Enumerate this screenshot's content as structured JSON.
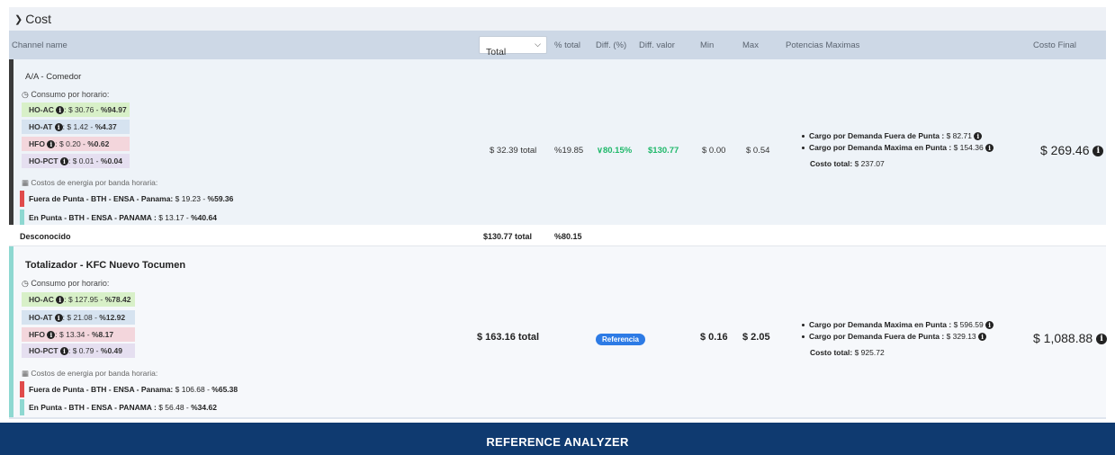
{
  "section": {
    "label": "Cost"
  },
  "header": {
    "channel_name": "Channel name",
    "total_select": "Total",
    "pct_total": "% total",
    "diff_pct": "Diff. (%)",
    "diff_valor": "Diff. valor",
    "min": "Min",
    "max": "Max",
    "potencias": "Potencias Maximas",
    "costo_final": "Costo Final"
  },
  "row1": {
    "name": "A/A - Comedor",
    "consumo_label": "Consumo por horario:",
    "horarios": [
      {
        "code": "HO-AC",
        "value": ": $ 30.76 - ",
        "pct": "%94.97"
      },
      {
        "code": "HO-AT",
        "value": ": $ 1.42 - ",
        "pct": "%4.37"
      },
      {
        "code": "HFO",
        "value": ": $ 0.20 - ",
        "pct": "%0.62"
      },
      {
        "code": "HO-PCT",
        "value": ": $ 0.01 - ",
        "pct": "%0.04"
      }
    ],
    "energia_label": "Costos de energia por banda horaria:",
    "bandas": [
      {
        "name": "Fuera de Punta - BTH - ENSA - Panama:",
        "value": " $ 19.23 - ",
        "pct": "%59.36"
      },
      {
        "name": "En Punta - BTH - ENSA - PANAMA :",
        "value": " $ 13.17 - ",
        "pct": "%40.64"
      }
    ],
    "total": "$ 32.39 total",
    "pct_total": "%19.85",
    "diff_pct": "80.15%",
    "diff_valor": "$130.77",
    "min": "$ 0.00",
    "max": "$ 0.54",
    "potencias": [
      {
        "label": "Cargo por Demanda Fuera de Punta :",
        "value": " $ 82.71"
      },
      {
        "label": "Cargo por Demanda Maxima en Punta :",
        "value": " $ 154.36"
      }
    ],
    "costo_total_label": "Costo total:",
    "costo_total_value": " $ 237.07",
    "costo_final": "$ 269.46"
  },
  "desconocido": {
    "name": "Desconocido",
    "total": "$130.77 total",
    "pct_total": "%80.15"
  },
  "row2": {
    "name": "Totalizador - KFC Nuevo Tocumen",
    "consumo_label": "Consumo por horario:",
    "horarios": [
      {
        "code": "HO-AC",
        "value": ": $ 127.95 - ",
        "pct": "%78.42"
      },
      {
        "code": "HO-AT",
        "value": ": $ 21.08 - ",
        "pct": "%12.92"
      },
      {
        "code": "HFO",
        "value": ": $ 13.34 - ",
        "pct": "%8.17"
      },
      {
        "code": "HO-PCT",
        "value": ": $ 0.79 - ",
        "pct": "%0.49"
      }
    ],
    "energia_label": "Costos de energia por banda horaria:",
    "bandas": [
      {
        "name": "Fuera de Punta - BTH - ENSA - Panama:",
        "value": " $ 106.68 - ",
        "pct": "%65.38"
      },
      {
        "name": "En Punta - BTH - ENSA - PANAMA :",
        "value": " $ 56.48 - ",
        "pct": "%34.62"
      }
    ],
    "total": "$ 163.16 total",
    "badge": "Referencia",
    "min": "$ 0.16",
    "max": "$ 2.05",
    "potencias": [
      {
        "label": "Cargo por Demanda Maxima en Punta :",
        "value": " $ 596.59"
      },
      {
        "label": "Cargo por Demanda Fuera de Punta :",
        "value": " $ 329.13"
      }
    ],
    "costo_total_label": "Costo total:",
    "costo_total_value": " $ 925.72",
    "costo_final": "$ 1,088.88"
  },
  "footer": {
    "title": "REFERENCE ANALYZER"
  },
  "colors": {
    "stripe_row1": "#3a3a3a",
    "stripe_row2": "#8ed8d1",
    "band_fuera": "#e04b4b",
    "band_punta": "#8ed8d1",
    "ho_ac": "#d8f0c8",
    "ho_at": "#d6e3f0",
    "hfo": "#f3d6dc",
    "ho_pct": "#e5dff0",
    "green": "#1fb86a",
    "badge": "#2d7be5",
    "footer": "#0f3a70"
  }
}
